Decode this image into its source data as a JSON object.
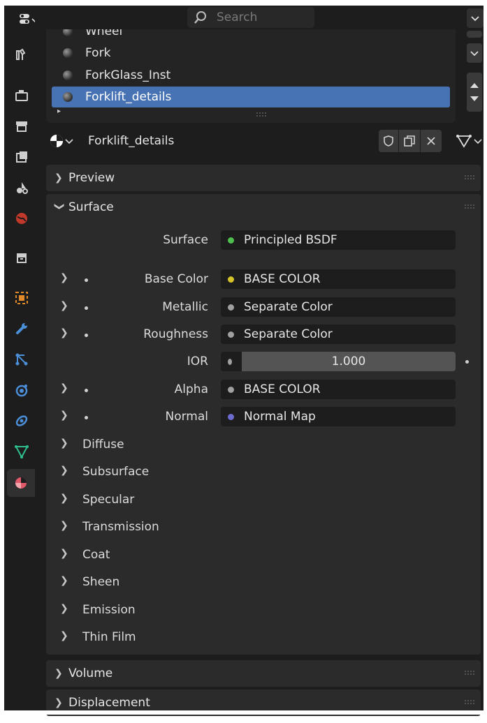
{
  "topbar": {
    "search_placeholder": "Search"
  },
  "material_list": {
    "items": [
      {
        "label": "Wheel"
      },
      {
        "label": "Fork"
      },
      {
        "label": "ForkGlass_Inst"
      },
      {
        "label": "Forklift_details",
        "selected": true
      }
    ]
  },
  "material_slot": {
    "name": "Forklift_details"
  },
  "panels": {
    "preview": "Preview",
    "surface": "Surface",
    "volume": "Volume",
    "displacement": "Displacement"
  },
  "surface": {
    "shader_label": "Surface",
    "shader_value": "Principled BSDF",
    "shader_socket_color": "#4fbf4f",
    "inputs": [
      {
        "label": "Base Color",
        "value": "BASE COLOR",
        "socket_color": "#d4c42a"
      },
      {
        "label": "Metallic",
        "value": "Separate Color",
        "socket_color": "#a0a0a0"
      },
      {
        "label": "Roughness",
        "value": "Separate Color",
        "socket_color": "#a0a0a0"
      },
      {
        "label": "IOR",
        "value": "1.000",
        "socket_color": "#a0a0a0"
      },
      {
        "label": "Alpha",
        "value": "BASE COLOR",
        "socket_color": "#a0a0a0"
      },
      {
        "label": "Normal",
        "value": "Normal Map",
        "socket_color": "#6b6bd0"
      }
    ],
    "subpanels": [
      "Diffuse",
      "Subsurface",
      "Specular",
      "Transmission",
      "Coat",
      "Sheen",
      "Emission",
      "Thin Film"
    ]
  },
  "colors": {
    "accent": "#4772b3",
    "editor_bg": "#1d1d1d",
    "panel_bg": "#2b2b2b"
  }
}
